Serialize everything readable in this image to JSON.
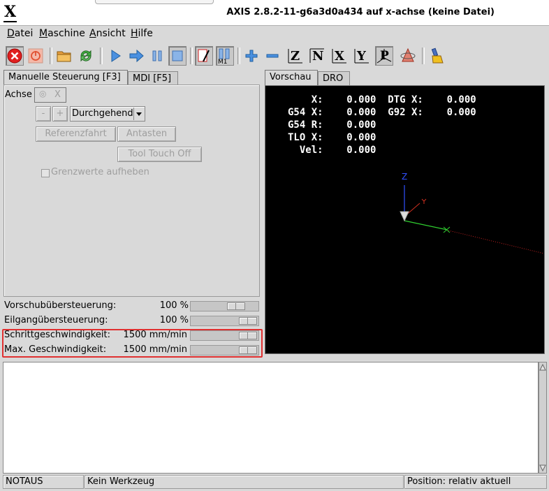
{
  "window": {
    "title": "AXIS 2.8.2-11-g6a3d0a434 auf  x-achse (keine Datei)"
  },
  "menu": [
    {
      "label": "Datei",
      "u": "D",
      "rest": "atei"
    },
    {
      "label": "Maschine",
      "u": "M",
      "rest": "aschine"
    },
    {
      "label": "Ansicht",
      "u": "A",
      "rest": "nsicht"
    },
    {
      "label": "Hilfe",
      "u": "H",
      "rest": "ilfe"
    }
  ],
  "toolbar": {
    "icons": [
      "estop-icon",
      "machine-power-icon",
      "open-file-icon",
      "reload-icon",
      "run-icon",
      "step-icon",
      "pause-icon",
      "stop-icon",
      "block-delete-icon",
      "optional-stop-icon",
      "zoom-in-icon",
      "zoom-out-icon",
      "view-z-icon",
      "view-z2-icon",
      "view-x-icon",
      "view-y-icon",
      "view-p-icon",
      "rotate-icon",
      "clear-plot-icon"
    ],
    "m1_label": "M1"
  },
  "left_tabs": [
    "Manuelle Steuerung [F3]",
    "MDI [F5]"
  ],
  "manual": {
    "axis_label": "Achse",
    "axis_value": "X",
    "minus": "-",
    "plus": "+",
    "jog_mode": "Durchgehend",
    "home_button": "Referenzfahrt",
    "touch_button": "Antasten",
    "tool_touch_button": "Tool Touch Off",
    "limits_label": "Grenzwerte aufheben"
  },
  "overrides": [
    {
      "label": "Vorschubübersteuerung:",
      "value": "100 %",
      "fraction": 0.75
    },
    {
      "label": "Eilgangübersteuerung:",
      "value": "100 %",
      "fraction": 1.0
    },
    {
      "label": "Schrittgeschwindigkeit:",
      "value": "1500 mm/min",
      "fraction": 1.0
    },
    {
      "label": "Max. Geschwindigkeit:",
      "value": "1500 mm/min",
      "fraction": 1.0
    }
  ],
  "right_tabs": [
    "Vorschau",
    "DRO"
  ],
  "dro": {
    "lines": [
      "    X:    0.000  DTG X:    0.000",
      "G54 X:    0.000  G92 X:    0.000",
      "G54 R:    0.000",
      "TLO X:    0.000",
      "  Vel:    0.000"
    ],
    "axis_z": "Z",
    "colors": {
      "z": "#3050ff",
      "x": "#30d030",
      "y": "#d03020",
      "text": "#ffffff"
    }
  },
  "status": {
    "machine": "NOTAUS",
    "tool": "Kein Werkzeug",
    "position": "Position: relativ aktuell"
  },
  "colors": {
    "highlight": "#e03030",
    "estop": "#e02020"
  }
}
